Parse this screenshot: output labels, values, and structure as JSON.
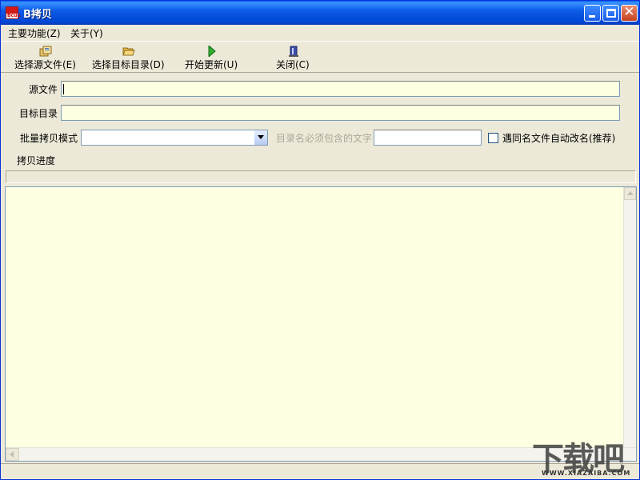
{
  "window": {
    "title": "B拷贝",
    "app_icon_text": "Bcuu"
  },
  "menubar": {
    "items": [
      {
        "label": "主要功能(Z)"
      },
      {
        "label": "关于(Y)"
      }
    ]
  },
  "toolbar": {
    "buttons": [
      {
        "label": "选择源文件(E)",
        "icon": "copy-files-icon"
      },
      {
        "label": "选择目标目录(D)",
        "icon": "open-folder-icon"
      },
      {
        "label": "开始更新(U)",
        "icon": "play-arrow-icon"
      },
      {
        "label": "关闭(C)",
        "icon": "exit-door-icon"
      }
    ]
  },
  "form": {
    "source_label": "源文件",
    "source_value": "",
    "target_label": "目标目录",
    "target_value": "",
    "batch_mode_label": "批量拷贝模式",
    "batch_mode_value": "",
    "dir_filter_label": "目录名必须包含的文字",
    "dir_filter_value": "",
    "auto_rename_label": "遇同名文件自动改名(推荐)",
    "auto_rename_checked": false,
    "progress_label": "拷贝进度",
    "progress_value": 0
  },
  "log": {
    "text": ""
  },
  "watermark": {
    "text": "下载吧",
    "sub": "WWW.XIAZAIBA.COM"
  },
  "colors": {
    "titlebar": "#0054E3",
    "window_bg": "#ECE9D8",
    "field_bg": "#FFFFE1"
  }
}
